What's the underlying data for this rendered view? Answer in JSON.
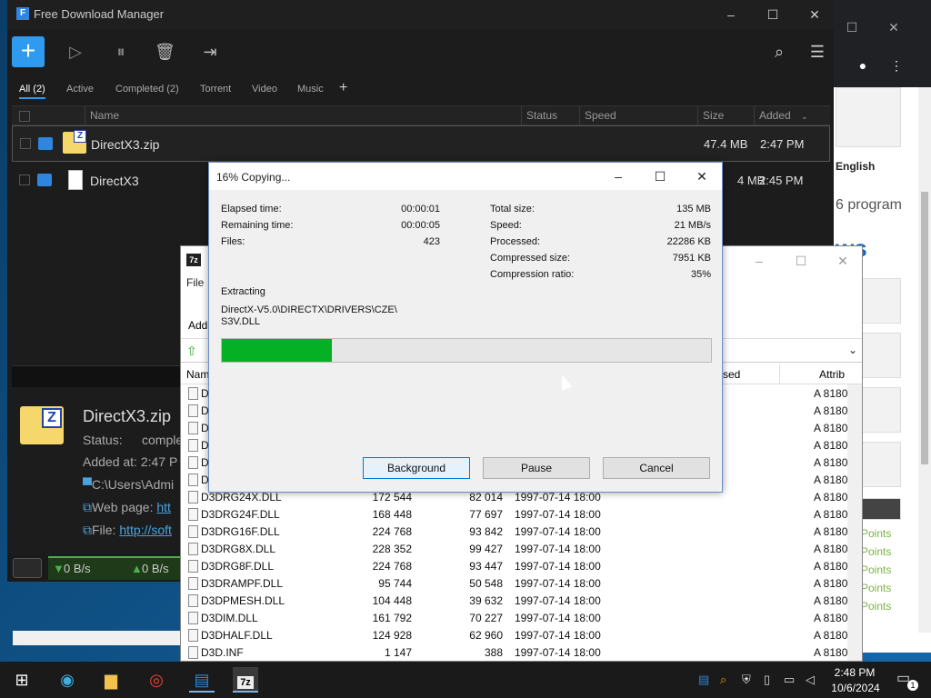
{
  "browser": {
    "language": "English",
    "programs_text": "6 program",
    "news_text": "ws",
    "points": [
      "Points",
      "Points",
      "Points",
      "Points",
      "Points"
    ]
  },
  "fdm": {
    "title": "Free Download Manager",
    "logo_text": "F",
    "tabs": [
      "All (2)",
      "Active",
      "Completed (2)",
      "Torrent",
      "Video",
      "Music"
    ],
    "columns": {
      "name": "Name",
      "status": "Status",
      "speed": "Speed",
      "size": "Size",
      "added": "Added"
    },
    "rows": [
      {
        "name": "DirectX3.zip",
        "size": "47.4 MB",
        "added": "2:47 PM"
      },
      {
        "name": "DirectX3",
        "size": "4 MB",
        "added": "2:45 PM"
      }
    ],
    "details": {
      "name": "DirectX3.zip",
      "status_label": "Status:",
      "status_value": "comple",
      "added": "Added at: 2:47 P",
      "path": "C:\\Users\\Admi",
      "web_label": "Web page: ",
      "web_value": "htt",
      "file_label": "File: ",
      "file_value": "http://soft"
    },
    "speed_down": "0 B/s",
    "speed_up": "0 B/s"
  },
  "zm": {
    "menu": "File",
    "add_label": "Add",
    "col_name": "Nam",
    "col_packed": "ssed",
    "col_attr": "Attrib",
    "rows": [
      {
        "n": "D3",
        "s": "",
        "p": "",
        "m": "",
        "a": "A 8180"
      },
      {
        "n": "D3",
        "s": "",
        "p": "",
        "m": "",
        "a": "A 8180"
      },
      {
        "n": "D",
        "s": "",
        "p": "",
        "m": "",
        "a": "A 8180"
      },
      {
        "n": "D",
        "s": "",
        "p": "",
        "m": "",
        "a": "A 8180"
      },
      {
        "n": "D",
        "s": "",
        "p": "",
        "m": "",
        "a": "A 8180"
      },
      {
        "n": "D",
        "s": "",
        "p": "",
        "m": "",
        "a": "A 8180"
      },
      {
        "n": "D3DRG24X.DLL",
        "s": "172 544",
        "p": "82 014",
        "m": "1997-07-14 18:00",
        "a": "A 8180"
      },
      {
        "n": "D3DRG24F.DLL",
        "s": "168 448",
        "p": "77 697",
        "m": "1997-07-14 18:00",
        "a": "A 8180"
      },
      {
        "n": "D3DRG16F.DLL",
        "s": "224 768",
        "p": "93 842",
        "m": "1997-07-14 18:00",
        "a": "A 8180"
      },
      {
        "n": "D3DRG8X.DLL",
        "s": "228 352",
        "p": "99 427",
        "m": "1997-07-14 18:00",
        "a": "A 8180"
      },
      {
        "n": "D3DRG8F.DLL",
        "s": "224 768",
        "p": "93 447",
        "m": "1997-07-14 18:00",
        "a": "A 8180"
      },
      {
        "n": "D3DRAMPF.DLL",
        "s": "95 744",
        "p": "50 548",
        "m": "1997-07-14 18:00",
        "a": "A 8180"
      },
      {
        "n": "D3DPMESH.DLL",
        "s": "104 448",
        "p": "39 632",
        "m": "1997-07-14 18:00",
        "a": "A 8180"
      },
      {
        "n": "D3DIM.DLL",
        "s": "161 792",
        "p": "70 227",
        "m": "1997-07-14 18:00",
        "a": "A 8180"
      },
      {
        "n": "D3DHALF.DLL",
        "s": "124 928",
        "p": "62 960",
        "m": "1997-07-14 18:00",
        "a": "A 8180"
      },
      {
        "n": "D3D.INF",
        "s": "1 147",
        "p": "388",
        "m": "1997-07-14 18:00",
        "a": "A 8180"
      }
    ]
  },
  "dialog": {
    "title": "16% Copying...",
    "elapsed_label": "Elapsed time:",
    "elapsed": "00:00:01",
    "remaining_label": "Remaining time:",
    "remaining": "00:00:05",
    "files_label": "Files:",
    "files": "423",
    "total_label": "Total size:",
    "total": "135 MB",
    "speed_label": "Speed:",
    "speed": "21 MB/s",
    "processed_label": "Processed:",
    "processed": "22286 KB",
    "compressed_label": "Compressed size:",
    "compressed": "7951 KB",
    "ratio_label": "Compression ratio:",
    "ratio": "35%",
    "op": "Extracting",
    "path_line1": "DirectX-V5.0\\DIRECTX\\DRIVERS\\CZE\\",
    "path_line2": "S3V.DLL",
    "progress": 0.225,
    "btn_background": "Background",
    "btn_pause": "Pause",
    "btn_cancel": "Cancel"
  },
  "taskbar": {
    "time": "2:48 PM",
    "date": "10/6/2024",
    "zip_label": "7z",
    "notif_count": "1"
  }
}
